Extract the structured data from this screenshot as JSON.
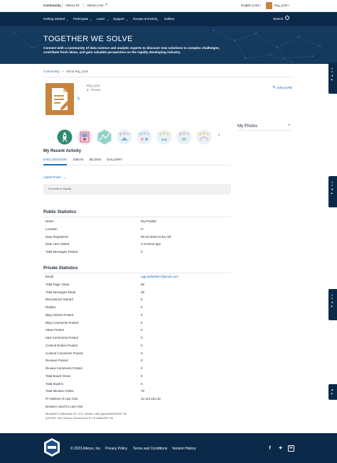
{
  "topbar": {
    "community": "Community",
    "alteryx_id": "Alteryx ID",
    "alteryx_com": "Alteryx.com",
    "language": "English (US)",
    "user": "Raj_ry18",
    "language_chevron": "chevron-down-icon",
    "user_chevron": "chevron-down-icon"
  },
  "nav": {
    "items": [
      "Getting Started",
      "Participate",
      "Learn",
      "Support",
      "Groups & Events",
      "Gallery"
    ],
    "search": "Search"
  },
  "hero": {
    "title": "TOGETHER WE SOLVE",
    "subtitle": "Connect with a community of data science and analytic experts to discover new solutions to complex challenges, contribute fresh ideas, and gain valuable perspective on the rapidly developing industry."
  },
  "breadcrumb": {
    "home": "Community",
    "separator": ">",
    "current": "About Raj_ry18"
  },
  "profile": {
    "username": "Raj_ry18",
    "rank": "5 - Proton",
    "edit_profile": "Edit profile"
  },
  "my_photos": {
    "title": "My Photos",
    "add": "+"
  },
  "recent_activity": {
    "title": "My Recent Activity",
    "tabs": [
      "DISCUSSIONS",
      "IDEAS",
      "BLOGS",
      "GALLERY"
    ],
    "active_tab": "DISCUSSIONS",
    "filter": "Latest Posts",
    "empty": "No posts to display."
  },
  "public_stats": {
    "title": "Public Statistics",
    "rows": [
      {
        "label": "Name",
        "value": "Raj Poddar"
      },
      {
        "label": "Location",
        "value": "In"
      },
      {
        "label": "Date Registered",
        "value": "05-23-2023 01:53 AM"
      },
      {
        "label": "Date Last Visited",
        "value": "a moment ago"
      },
      {
        "label": "Total Messages Posted",
        "value": "0"
      }
    ]
  },
  "private_stats": {
    "title": "Private Statistics",
    "rows": [
      {
        "label": "Email",
        "value": "rajpoddar8907@gmail.com"
      },
      {
        "label": "Total Page Views",
        "value": "68"
      },
      {
        "label": "Total Messages Read",
        "value": "48"
      },
      {
        "label": "Discussions Started",
        "value": "0"
      },
      {
        "label": "Replies",
        "value": "0"
      },
      {
        "label": "Blog Articles Posted",
        "value": "0"
      },
      {
        "label": "Blog Comments Posted",
        "value": "0"
      },
      {
        "label": "Ideas Posted",
        "value": "0"
      },
      {
        "label": "Idea Comments Posted",
        "value": "0"
      },
      {
        "label": "Contest Entries Posted",
        "value": "0"
      },
      {
        "label": "Contest Comments Posted",
        "value": "0"
      },
      {
        "label": "Reviews Posted",
        "value": "0"
      },
      {
        "label": "Review Comments Posted",
        "value": "0"
      },
      {
        "label": "Total Board Views",
        "value": "8"
      },
      {
        "label": "Total Signins",
        "value": "3"
      },
      {
        "label": "Total Minutes Online",
        "value": "78"
      },
      {
        "label": "IP Address of Last Visit",
        "value": "42.110.163.19"
      },
      {
        "label": "Browser used for Last Visit",
        "value": ""
      }
    ],
    "browser_ua": "Mozilla/5.0 (Windows NT 10.0; Win64; x64) AppleWebKit/537.36 (KHTML, like Gecko) Chrome/114.0.0.0 Safari/537.36"
  },
  "footer": {
    "copyright": "© 2023 Alteryx, Inc.",
    "privacy": "Privacy Policy",
    "terms": "Terms and Conditions",
    "version": "Version History",
    "social": [
      "facebook-icon",
      "twitter-icon",
      "linkedin-icon"
    ]
  },
  "colors": {
    "navy": "#0b2a4a",
    "hero": "#143a5e",
    "link": "#1d6fb8",
    "avatar": "#c8843e"
  }
}
